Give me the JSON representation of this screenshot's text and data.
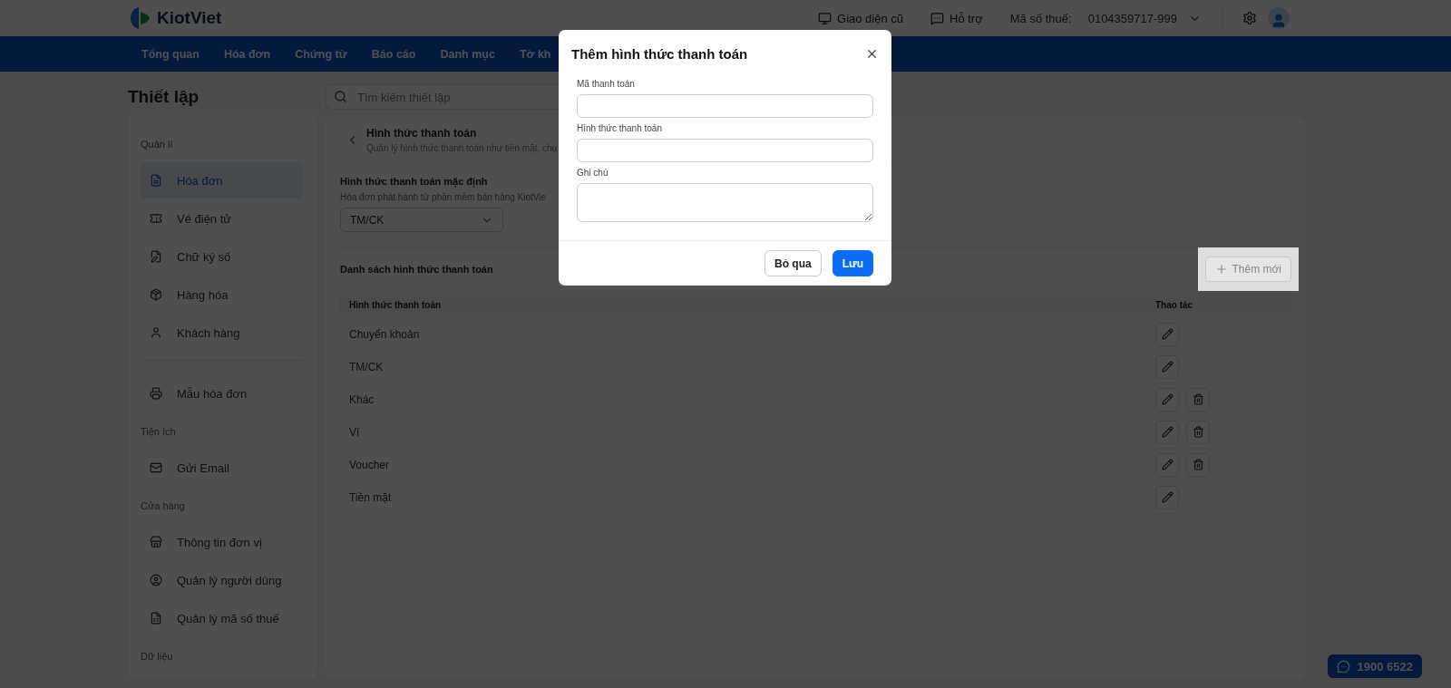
{
  "header": {
    "logo": "KiotViet",
    "links": [
      {
        "label": "Giao diện cũ"
      },
      {
        "label": "Hỗ trợ"
      }
    ],
    "tax_label": "Mã số thuế:",
    "tax_value": "0104359717-999"
  },
  "nav": {
    "items": [
      {
        "label": "Tổng quan"
      },
      {
        "label": "Hóa đơn"
      },
      {
        "label": "Chứng từ"
      },
      {
        "label": "Báo cáo"
      },
      {
        "label": "Danh mục"
      },
      {
        "label": "Tờ kh"
      }
    ]
  },
  "page_title": "Thiết lập",
  "search": {
    "placeholder": "Tìm kiếm thiết lập"
  },
  "sidebar": {
    "groups": [
      {
        "heading": "Quản lí",
        "items": [
          {
            "label": "Hóa đơn",
            "selected": true
          },
          {
            "label": "Vé điện tử",
            "selected": false
          },
          {
            "label": "Chữ ký số",
            "selected": false
          },
          {
            "label": "Hàng hóa",
            "selected": false
          },
          {
            "label": "Khách hàng",
            "selected": false
          }
        ]
      },
      {
        "items": [
          {
            "label": "Mẫu hóa đơn",
            "selected": false
          }
        ]
      },
      {
        "heading": "Tiện ích",
        "items": [
          {
            "label": "Gửi Email",
            "selected": false
          }
        ]
      },
      {
        "heading": "Cửa hàng",
        "items": [
          {
            "label": "Thông tin đơn vị",
            "selected": false
          },
          {
            "label": "Quản lý người dùng",
            "selected": false
          },
          {
            "label": "Quản lý mã số thuế",
            "selected": false
          }
        ]
      },
      {
        "heading": "Dữ liệu"
      }
    ]
  },
  "content": {
    "title": "Hình thức thanh toán",
    "subtitle": "Quản lý hình thức thanh toán như tiền mặt, chu",
    "default_section": {
      "title": "Hình thức thanh toán mặc định",
      "description": "Hóa đơn phát hành từ phần mềm bán hàng KiotVie",
      "select_value": "TM/CK"
    },
    "list_title": "Danh sách hình thức thanh toán",
    "add_button": "Thêm mới",
    "table": {
      "columns": [
        "Hình thức thanh toán",
        "Thao tác"
      ],
      "rows": [
        {
          "name": "Chuyển khoản",
          "deletable": false
        },
        {
          "name": "TM/CK",
          "deletable": false
        },
        {
          "name": "Khác",
          "deletable": true
        },
        {
          "name": "Ví",
          "deletable": true
        },
        {
          "name": "Voucher",
          "deletable": true
        },
        {
          "name": "Tiền mặt",
          "deletable": false
        }
      ]
    }
  },
  "modal": {
    "title": "Thêm hình thức thanh toán",
    "fields": [
      {
        "label": "Mã thanh toán",
        "kind": "input"
      },
      {
        "label": "Hình thức thanh toán",
        "kind": "input"
      },
      {
        "label": "Ghi chú",
        "kind": "textarea"
      }
    ],
    "buttons": [
      {
        "label": "Bỏ qua",
        "kind": "secondary"
      },
      {
        "label": "Lưu",
        "kind": "primary"
      }
    ]
  },
  "hotline": "1900 6522"
}
